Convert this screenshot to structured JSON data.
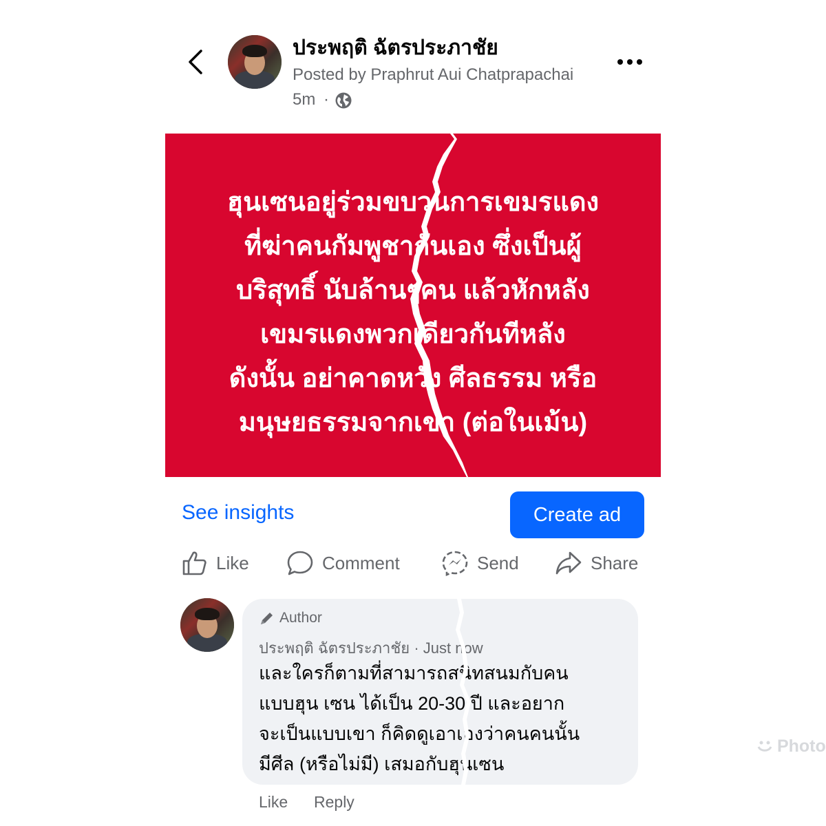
{
  "header": {
    "page_name": "ประพฤติ ฉัตรประภาชัย",
    "posted_by": "Posted by Praphrut Aui Chatprapachai",
    "time": "5m",
    "separator": "·",
    "audience_icon": "globe-icon",
    "back_icon": "chevron-left-icon",
    "more_icon": "more-horizontal-icon"
  },
  "post": {
    "image_background": "#d8062f",
    "image_text_lines": [
      "ฮุนเซนอยู่ร่วมขบวนการเขมรแดง",
      "ที่ฆ่าคนกัมพูชากันเอง ซึ่งเป็นผู้",
      "บริสุทธิ์ นับล้านๆคน แล้วหักหลัง",
      "เขมรแดงพวกเดียวกันทีหลัง",
      "ดังนั้น อย่าคาดหวัง ศีลธรรม หรือ",
      "มนุษยธรรมจากเขา (ต่อในเม้น)"
    ]
  },
  "insights": {
    "see_insights_label": "See insights",
    "create_ad_label": "Create ad",
    "accent_color": "#0866ff"
  },
  "actions": {
    "like_label": "Like",
    "comment_label": "Comment",
    "send_label": "Send",
    "share_label": "Share"
  },
  "comment": {
    "badge": "Author",
    "author_name": "ประพฤติ ฉัตรประภาชัย",
    "time": "Just now",
    "text_lines": [
      "และใครก็ตามที่สามารถสนิทสนมกับคน",
      "แบบฮุน เซน ได้เป็น 20-30 ปี และอยาก",
      "จะเป็นแบบเขา ก็คิดดูเอาเองว่าคนคนนั้น",
      "มีศีล (หรือไม่มี) เสมอกับฮุนเซน"
    ],
    "like_label": "Like",
    "reply_label": "Reply"
  },
  "watermark": "Photo"
}
